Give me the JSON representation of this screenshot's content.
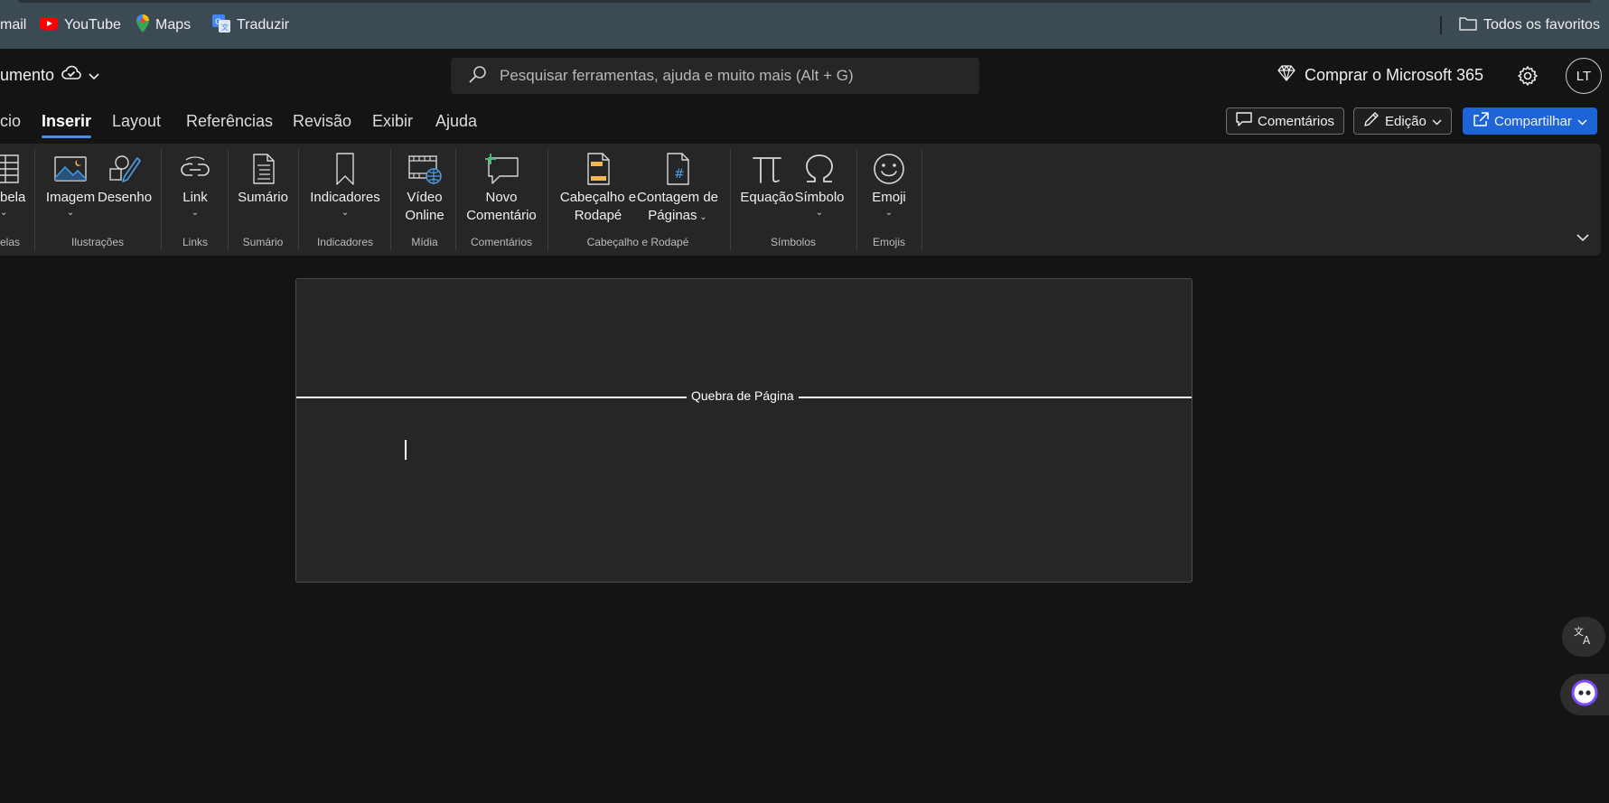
{
  "bookmarks": {
    "items": [
      {
        "label": "mail"
      },
      {
        "label": "YouTube"
      },
      {
        "label": "Maps"
      },
      {
        "label": "Traduzir"
      }
    ],
    "all_favorites": "Todos os favoritos"
  },
  "titlebar": {
    "doc_name": "umento",
    "search_placeholder": "Pesquisar ferramentas, ajuda e muito mais (Alt + G)",
    "buy_label": "Comprar o Microsoft 365",
    "avatar_initials": "LT"
  },
  "tabs": {
    "items": [
      "cio",
      "Inserir",
      "Layout",
      "Referências",
      "Revisão",
      "Exibir",
      "Ajuda"
    ],
    "active": "Inserir",
    "comments_label": "Comentários",
    "editing_label": "Edição",
    "share_label": "Compartilhar"
  },
  "ribbon": {
    "commands": {
      "table": "bela",
      "image": "Imagem",
      "drawing": "Desenho",
      "link": "Link",
      "toc": "Sumário",
      "bookmarks": "Indicadores",
      "video_1": "Vídeo",
      "video_2": "Online",
      "comment_1": "Novo",
      "comment_2": "Comentário",
      "header_1": "Cabeçalho e",
      "header_2": "Rodapé",
      "pagenum_1": "Contagem de",
      "pagenum_2": "Páginas",
      "equation": "Equação",
      "symbol": "Símbolo",
      "emoji": "Emoji"
    },
    "groups": {
      "tables": "elas",
      "illustrations": "Ilustrações",
      "links": "Links",
      "toc": "Sumário",
      "bookmarks": "Indicadores",
      "media": "Mídia",
      "comments": "Comentários",
      "header_footer": "Cabeçalho e Rodapé",
      "symbols": "Símbolos",
      "emojis": "Emojis"
    }
  },
  "document": {
    "page_break_label": "Quebra de Página"
  },
  "colors": {
    "accent": "#1d65d6",
    "tab_underline": "#4a8ff0",
    "bookmarks_bg": "#3c4a53",
    "ribbon_bg": "#262626"
  }
}
